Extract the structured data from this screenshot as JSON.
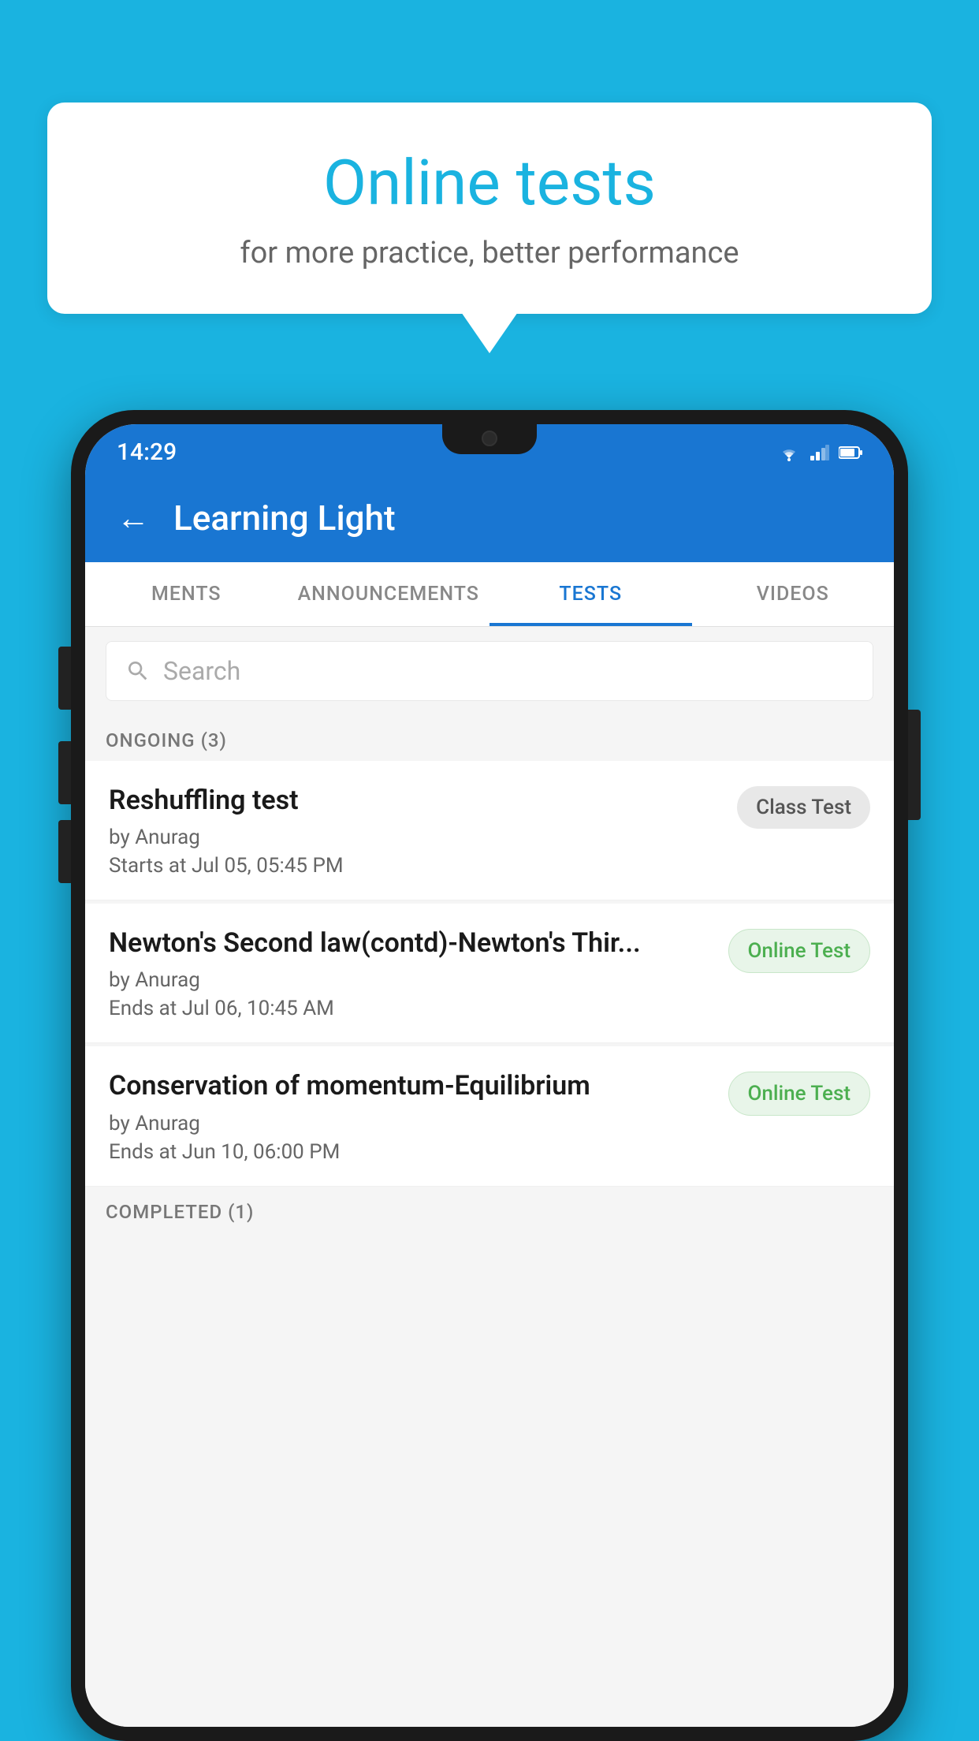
{
  "background_color": "#1ab3e0",
  "speech_bubble": {
    "title": "Online tests",
    "subtitle": "for more practice, better performance"
  },
  "phone": {
    "status_bar": {
      "time": "14:29",
      "icons": [
        "wifi",
        "signal",
        "battery"
      ]
    },
    "app_bar": {
      "back_label": "←",
      "title": "Learning Light"
    },
    "tabs": [
      {
        "label": "MENTS",
        "active": false
      },
      {
        "label": "ANNOUNCEMENTS",
        "active": false
      },
      {
        "label": "TESTS",
        "active": true
      },
      {
        "label": "VIDEOS",
        "active": false
      }
    ],
    "search": {
      "placeholder": "Search"
    },
    "ongoing_section": {
      "label": "ONGOING (3)",
      "tests": [
        {
          "title": "Reshuffling test",
          "by": "by Anurag",
          "date": "Starts at  Jul 05, 05:45 PM",
          "badge": "Class Test",
          "badge_type": "class"
        },
        {
          "title": "Newton's Second law(contd)-Newton's Thir...",
          "by": "by Anurag",
          "date": "Ends at  Jul 06, 10:45 AM",
          "badge": "Online Test",
          "badge_type": "online"
        },
        {
          "title": "Conservation of momentum-Equilibrium",
          "by": "by Anurag",
          "date": "Ends at  Jun 10, 06:00 PM",
          "badge": "Online Test",
          "badge_type": "online"
        }
      ]
    },
    "completed_section": {
      "label": "COMPLETED (1)"
    }
  }
}
